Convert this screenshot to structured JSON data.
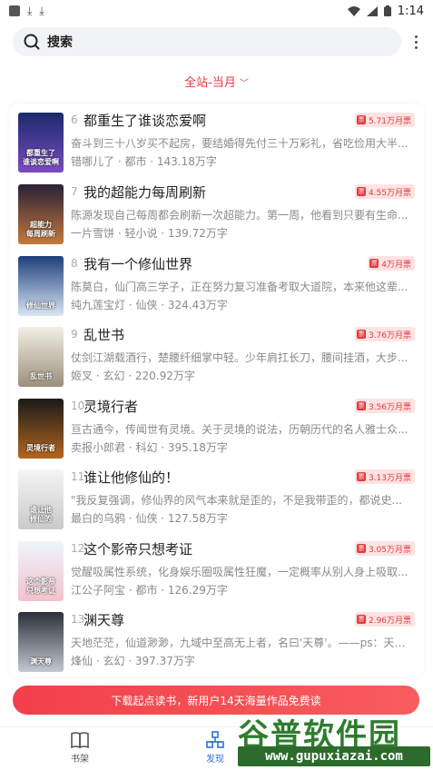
{
  "status_bar": {
    "time": "1:14",
    "icons": [
      "notification-square-icon",
      "download-icon",
      "download-icon",
      "wifi-icon",
      "signal-icon",
      "battery-icon"
    ]
  },
  "search": {
    "label": "搜索"
  },
  "filter": {
    "label": "全站-当月"
  },
  "books": [
    {
      "rank": "6",
      "title": "都重生了谁谈恋爱啊",
      "badge": "5.71万月票",
      "desc": "奋斗到三十八岁买不起房，要结婚得先付三十万彩礼，省吃俭用大半...",
      "meta": "错哪儿了 · 都市 · 143.18万字"
    },
    {
      "rank": "7",
      "title": "我的超能力每周刷新",
      "badge": "4.55万月票",
      "desc": "陈源发现自己每周都会刷新一次超能力。第一周，他看到只要有生命...",
      "meta": "一片雪饼 · 轻小说 · 139.72万字"
    },
    {
      "rank": "8",
      "title": "我有一个修仙世界",
      "badge": "4万月票",
      "desc": "陈莫白，仙门高三学子，正在努力复习准备考取大道院，本来他这辈...",
      "meta": "纯九莲宝灯 · 仙侠 · 324.43万字"
    },
    {
      "rank": "9",
      "title": "乱世书",
      "badge": "3.76万月票",
      "desc": "仗剑江湖载酒行，楚腰纤细掌中轻。少年肩扛长刀，腰间挂酒，大步...",
      "meta": "姬叉 · 玄幻 · 220.92万字"
    },
    {
      "rank": "10",
      "title": "灵境行者",
      "badge": "3.56万月票",
      "desc": "亘古通今，传闻世有灵境。关于灵境的说法，历朝历代的名人雅士众...",
      "meta": "卖报小郎君 · 科幻 · 395.18万字"
    },
    {
      "rank": "11",
      "title": "谁让他修仙的！",
      "badge": "3.13万月票",
      "desc": "\"我反复强调，修仙界的风气本来就是歪的，不是我带歪的，都说史...",
      "meta": "最白的乌鸦 · 仙侠 · 127.58万字"
    },
    {
      "rank": "12",
      "title": "这个影帝只想考证",
      "badge": "3.05万月票",
      "desc": "觉醒吸属性系统，化身娱乐圈吸属性狂魔，一定概率从别人身上吸取...",
      "meta": "江公子阿宝 · 都市 · 126.29万字"
    },
    {
      "rank": "13",
      "title": "渊天尊",
      "badge": "2.96万月票",
      "desc": "天地茫茫，仙道渺渺，九域中至高无上者，名曰'天尊'。——ps：天才...",
      "meta": "烽仙 · 玄幻 · 397.37万字"
    }
  ],
  "covers": [
    {
      "name": "cover-book-6",
      "top": "#1b2a6b",
      "bottom": "#7a4cc2",
      "text": "都重生了\n谁谈恋爱啊"
    },
    {
      "name": "cover-book-7",
      "top": "#2a2038",
      "bottom": "#c57a3a",
      "text": "超能力\n每周刷新"
    },
    {
      "name": "cover-book-8",
      "top": "#1d3f7a",
      "bottom": "#d9e6f5",
      "text": "修仙世界"
    },
    {
      "name": "cover-book-9",
      "top": "#f3efe6",
      "bottom": "#9a8f7a",
      "text": "乱世书"
    },
    {
      "name": "cover-book-10",
      "top": "#1a1a1a",
      "bottom": "#b3661f",
      "text": "灵境行者"
    },
    {
      "name": "cover-book-11",
      "top": "#f5f5f5",
      "bottom": "#c9c9c9",
      "text": "谁让他\n修仙的"
    },
    {
      "name": "cover-book-12",
      "top": "#eef5fb",
      "bottom": "#f3c2cc",
      "text": "这个影帝\n只想考证"
    },
    {
      "name": "cover-book-13",
      "top": "#2b2f3a",
      "bottom": "#c4c8d0",
      "text": "渊天尊"
    }
  ],
  "promo": {
    "text": "下载起点读书，新用户14天海量作品免费读"
  },
  "bottom_nav": [
    {
      "label": "书架",
      "icon": "book-icon",
      "active": false
    },
    {
      "label": "发现",
      "icon": "discover-icon",
      "active": true
    }
  ],
  "watermark": {
    "title": "谷普软件园",
    "url": "www.gupuxiazai.com"
  },
  "colors": {
    "accent": "#e4393c",
    "active_nav": "#2f6fd6",
    "watermark_green": "#2f7d2f"
  }
}
